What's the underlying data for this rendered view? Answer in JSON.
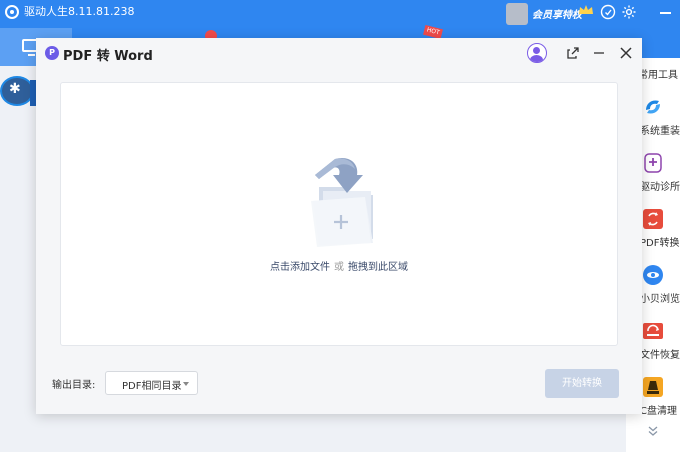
{
  "app": {
    "title": "驱动人生8.11.81.238",
    "vip_label": "会员享特权",
    "hot_badge": "HOT"
  },
  "tool_panel": {
    "title": "常用工具",
    "items": [
      {
        "label": "系统重装",
        "icon": "reinstall-icon",
        "color": "#1e88e5"
      },
      {
        "label": "驱动诊所",
        "icon": "clinic-icon",
        "color": "#8e44ad"
      },
      {
        "label": "PDF转换",
        "icon": "pdf-convert-icon",
        "color": "#e74c3c"
      },
      {
        "label": "小贝浏览器",
        "icon": "browser-icon",
        "color": "#2f86f0"
      },
      {
        "label": "文件恢复",
        "icon": "file-recover-icon",
        "color": "#e74c3c"
      },
      {
        "label": "C盘清理",
        "icon": "disk-clean-icon",
        "color": "#f39c12"
      }
    ]
  },
  "dialog": {
    "title": "PDF 转 Word",
    "drop_add_file": "点击添加文件",
    "drop_or": "或",
    "drop_drag": "拖拽到此区域",
    "output_label": "输出目录:",
    "output_value": "PDF相同目录",
    "start_label": "开始转换"
  },
  "colors": {
    "header_blue": "#2f86f0",
    "dialog_bg": "#f5f6f8",
    "start_button_disabled": "#c7d3e6",
    "dialog_logo": "#6c5ce7"
  }
}
